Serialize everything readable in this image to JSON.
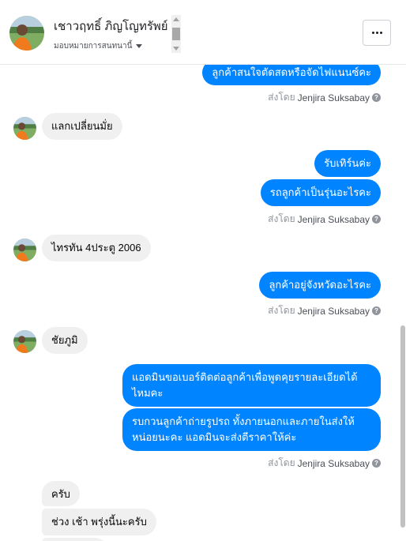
{
  "header": {
    "contact_name": "เชาวฤทธิ์ ภิญโญทรัพย์",
    "assign_label": "มอบหมายการสนทนานี้",
    "more_label": "..."
  },
  "messages": {
    "m1": "ลูกค้าสนใจตัดสดหรือจัดไฟแนนซ์คะ",
    "sent1": "ส่งโดย",
    "sender1": "Jenjira Suksabay",
    "m2": "แลกเปลี่ยนมั่ย",
    "m3": "รับเทิร์นค่ะ",
    "m4": "รถลูกค้าเป็นรุ่นอะไรคะ",
    "sent2": "ส่งโดย",
    "sender2": "Jenjira Suksabay",
    "m5": "ไทรทัน 4ประตู 2006",
    "m6": "ลูกค้าอยู่จังหวัดอะไรคะ",
    "sent3": "ส่งโดย",
    "sender3": "Jenjira Suksabay",
    "m7": "ชัยภูมิ",
    "m8_line1": "แอดมินขอเบอร์ติดต่อลูกค้าเพื่อพูดคุยรายละเอียดได้",
    "m8_line2": "ไหมคะ",
    "m9_line1": "รบกวนลูกค้าถ่ายรูปรถ ทั้งภายนอกและภายในส่งให้",
    "m9_line2": "หน่อยนะคะ แอดมินจะส่งตีราคาให้ค่ะ",
    "sent4": "ส่งโดย",
    "sender4": "Jenjira Suksabay",
    "m10": "ครับ",
    "m11": "ช่วง เช้า พรุ่งนี้นะครับ"
  },
  "colors": {
    "outgoing_bubble": "#0084ff",
    "incoming_bubble": "#f0f0f0"
  },
  "icons": {
    "more": "ellipsis-icon",
    "help": "question-circle-icon",
    "caret": "caret-down-icon"
  }
}
